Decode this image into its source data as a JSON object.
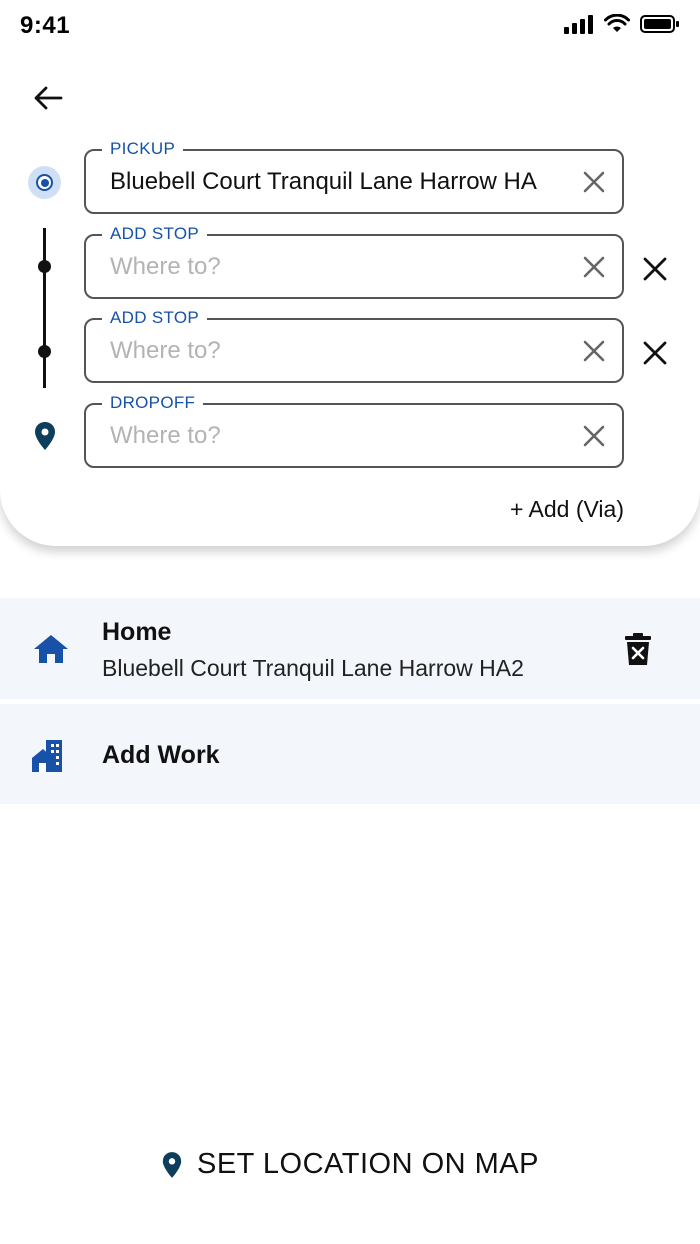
{
  "status": {
    "time": "9:41"
  },
  "header": {
    "back_icon": "arrow-left-icon"
  },
  "fields": {
    "pickup": {
      "label": "PICKUP",
      "value": "Bluebell Court Tranquil Lane Harrow HA"
    },
    "stop1": {
      "label": "ADD STOP",
      "placeholder": "Where to?"
    },
    "stop2": {
      "label": "ADD STOP",
      "placeholder": "Where to?"
    },
    "dropoff": {
      "label": "DROPOFF",
      "placeholder": "Where to?"
    }
  },
  "add_via": {
    "label": "+ Add (Via)"
  },
  "saved": {
    "home": {
      "title": "Home",
      "address": "Bluebell Court Tranquil Lane Harrow HA2",
      "icon": "home-icon",
      "delete_icon": "trash-icon"
    },
    "work": {
      "title": "Add Work",
      "icon": "building-icon"
    }
  },
  "footer": {
    "set_location_label": "SET LOCATION ON MAP",
    "icon": "location-pin-icon"
  },
  "colors": {
    "accent": "#1751a8",
    "pin_dark": "#0d3f5c",
    "row_bg": "#f3f6fa"
  }
}
